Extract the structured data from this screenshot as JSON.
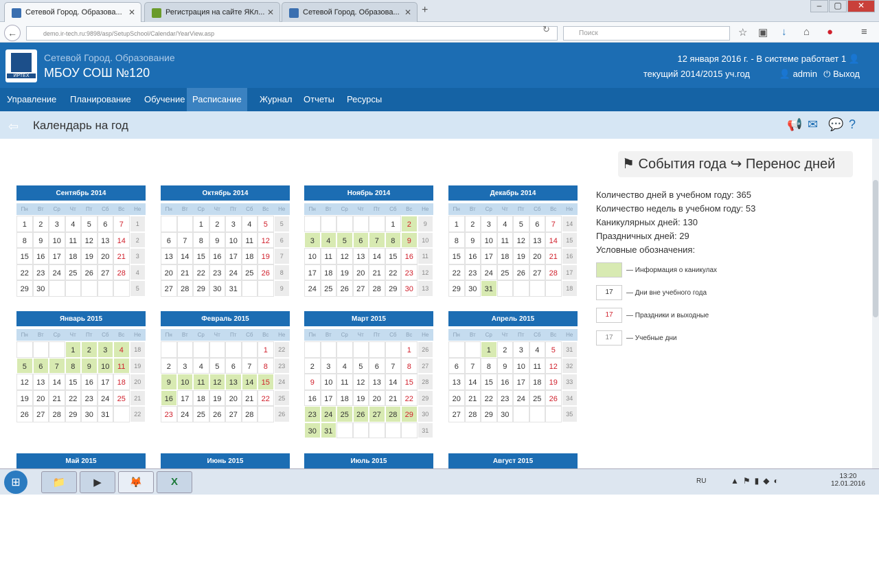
{
  "browser": {
    "tabs": [
      {
        "title": "Сетевой Город. Образова...",
        "favicon": "#3a6fb0",
        "active": true
      },
      {
        "title": "Регистрация на сайте ЯКл...",
        "favicon": "#6a9b2a",
        "active": false
      },
      {
        "title": "Сетевой Город. Образова...",
        "favicon": "#3a6fb0",
        "active": false
      }
    ],
    "url": "demo.ir-tech.ru:9898/asp/SetupSchool/Calendar/YearView.asp",
    "search_placeholder": "Поиск",
    "toolbar_icons": [
      "star-icon",
      "clipboard-icon",
      "download-icon",
      "home-icon",
      "adblock-icon",
      "menu-icon"
    ]
  },
  "app": {
    "system_name": "Сетевой Город. Образование",
    "school": "МБОУ СОШ №120",
    "logo_text": "ИРТЕХ",
    "date_status": "12 января 2016 г. - В системе работает 1",
    "year": "текущий 2014/2015 уч.год",
    "user": "admin",
    "logout": "Выход"
  },
  "menu": [
    "Управление",
    "Планирование",
    "Обучение",
    "Расписание",
    "Журнал",
    "Отчеты",
    "Ресурсы"
  ],
  "menu_active_index": 3,
  "page_title": "Календарь на год",
  "events_button": "События года",
  "transfer_button": "Перенос дней",
  "weekdays": [
    "Пн",
    "Вт",
    "Ср",
    "Чт",
    "Пт",
    "Сб",
    "Вс",
    "Не"
  ],
  "months": [
    {
      "title": "Сентябрь 2014",
      "rows": [
        [
          "1",
          "2",
          "3",
          "4",
          "5",
          "6",
          "7",
          "1"
        ],
        [
          "8",
          "9",
          "10",
          "11",
          "12",
          "13",
          "14",
          "2"
        ],
        [
          "15",
          "16",
          "17",
          "18",
          "19",
          "20",
          "21",
          "3"
        ],
        [
          "22",
          "23",
          "24",
          "25",
          "26",
          "27",
          "28",
          "4"
        ],
        [
          "29",
          "30",
          "",
          "",
          "",
          "",
          "",
          "5"
        ]
      ],
      "types": [
        [
          "s",
          "s",
          "s",
          "s",
          "s",
          "s",
          "h",
          "w"
        ],
        [
          "s",
          "s",
          "s",
          "s",
          "s",
          "s",
          "h",
          "w"
        ],
        [
          "s",
          "s",
          "s",
          "s",
          "s",
          "s",
          "h",
          "w"
        ],
        [
          "s",
          "s",
          "s",
          "s",
          "s",
          "s",
          "h",
          "w"
        ],
        [
          "s",
          "s",
          "e",
          "e",
          "e",
          "e",
          "e",
          "w"
        ]
      ]
    },
    {
      "title": "Октябрь 2014",
      "rows": [
        [
          "",
          "",
          "1",
          "2",
          "3",
          "4",
          "5",
          "5"
        ],
        [
          "6",
          "7",
          "8",
          "9",
          "10",
          "11",
          "12",
          "6"
        ],
        [
          "13",
          "14",
          "15",
          "16",
          "17",
          "18",
          "19",
          "7"
        ],
        [
          "20",
          "21",
          "22",
          "23",
          "24",
          "25",
          "26",
          "8"
        ],
        [
          "27",
          "28",
          "29",
          "30",
          "31",
          "",
          "",
          "9"
        ]
      ],
      "types": [
        [
          "e",
          "e",
          "s",
          "s",
          "s",
          "s",
          "h",
          "w"
        ],
        [
          "s",
          "s",
          "s",
          "s",
          "s",
          "s",
          "h",
          "w"
        ],
        [
          "s",
          "s",
          "s",
          "s",
          "s",
          "s",
          "h",
          "w"
        ],
        [
          "s",
          "s",
          "s",
          "s",
          "s",
          "s",
          "h",
          "w"
        ],
        [
          "s",
          "s",
          "s",
          "s",
          "s",
          "e",
          "e",
          "w"
        ]
      ]
    },
    {
      "title": "Ноябрь 2014",
      "rows": [
        [
          "",
          "",
          "",
          "",
          "",
          "1",
          "2",
          "9"
        ],
        [
          "3",
          "4",
          "5",
          "6",
          "7",
          "8",
          "9",
          "10"
        ],
        [
          "10",
          "11",
          "12",
          "13",
          "14",
          "15",
          "16",
          "11"
        ],
        [
          "17",
          "18",
          "19",
          "20",
          "21",
          "22",
          "23",
          "12"
        ],
        [
          "24",
          "25",
          "26",
          "27",
          "28",
          "29",
          "30",
          "13"
        ]
      ],
      "types": [
        [
          "e",
          "e",
          "e",
          "e",
          "e",
          "s",
          "v",
          "w"
        ],
        [
          "v",
          "v",
          "v",
          "v",
          "v",
          "v",
          "v",
          "w"
        ],
        [
          "s",
          "s",
          "s",
          "s",
          "s",
          "s",
          "h",
          "w"
        ],
        [
          "s",
          "s",
          "s",
          "s",
          "s",
          "s",
          "h",
          "w"
        ],
        [
          "s",
          "s",
          "s",
          "s",
          "s",
          "s",
          "h",
          "w"
        ]
      ]
    },
    {
      "title": "Декабрь 2014",
      "rows": [
        [
          "1",
          "2",
          "3",
          "4",
          "5",
          "6",
          "7",
          "14"
        ],
        [
          "8",
          "9",
          "10",
          "11",
          "12",
          "13",
          "14",
          "15"
        ],
        [
          "15",
          "16",
          "17",
          "18",
          "19",
          "20",
          "21",
          "16"
        ],
        [
          "22",
          "23",
          "24",
          "25",
          "26",
          "27",
          "28",
          "17"
        ],
        [
          "29",
          "30",
          "31",
          "",
          "",
          "",
          "",
          "18"
        ]
      ],
      "types": [
        [
          "s",
          "s",
          "s",
          "s",
          "s",
          "s",
          "h",
          "w"
        ],
        [
          "s",
          "s",
          "s",
          "s",
          "s",
          "s",
          "h",
          "w"
        ],
        [
          "s",
          "s",
          "s",
          "s",
          "s",
          "s",
          "h",
          "w"
        ],
        [
          "s",
          "s",
          "s",
          "s",
          "s",
          "s",
          "h",
          "w"
        ],
        [
          "s",
          "s",
          "v",
          "e",
          "e",
          "e",
          "e",
          "w"
        ]
      ]
    },
    {
      "title": "Январь 2015",
      "rows": [
        [
          "",
          "",
          "",
          "1",
          "2",
          "3",
          "4",
          "18"
        ],
        [
          "5",
          "6",
          "7",
          "8",
          "9",
          "10",
          "11",
          "19"
        ],
        [
          "12",
          "13",
          "14",
          "15",
          "16",
          "17",
          "18",
          "20"
        ],
        [
          "19",
          "20",
          "21",
          "22",
          "23",
          "24",
          "25",
          "21"
        ],
        [
          "26",
          "27",
          "28",
          "29",
          "30",
          "31",
          "",
          "22"
        ]
      ],
      "types": [
        [
          "e",
          "e",
          "e",
          "v",
          "v",
          "v",
          "v",
          "w"
        ],
        [
          "v",
          "v",
          "v",
          "v",
          "v",
          "v",
          "v",
          "w"
        ],
        [
          "s",
          "s",
          "s",
          "s",
          "s",
          "s",
          "h",
          "w"
        ],
        [
          "s",
          "s",
          "s",
          "s",
          "s",
          "s",
          "h",
          "w"
        ],
        [
          "s",
          "s",
          "s",
          "s",
          "s",
          "s",
          "e",
          "w"
        ]
      ]
    },
    {
      "title": "Февраль 2015",
      "rows": [
        [
          "",
          "",
          "",
          "",
          "",
          "",
          "1",
          "22"
        ],
        [
          "2",
          "3",
          "4",
          "5",
          "6",
          "7",
          "8",
          "23"
        ],
        [
          "9",
          "10",
          "11",
          "12",
          "13",
          "14",
          "15",
          "24"
        ],
        [
          "16",
          "17",
          "18",
          "19",
          "20",
          "21",
          "22",
          "25"
        ],
        [
          "23",
          "24",
          "25",
          "26",
          "27",
          "28",
          "",
          "26"
        ]
      ],
      "types": [
        [
          "e",
          "e",
          "e",
          "e",
          "e",
          "e",
          "h",
          "w"
        ],
        [
          "s",
          "s",
          "s",
          "s",
          "s",
          "s",
          "h",
          "w"
        ],
        [
          "v",
          "v",
          "v",
          "v",
          "v",
          "v",
          "v",
          "w"
        ],
        [
          "v",
          "s",
          "s",
          "s",
          "s",
          "s",
          "h",
          "w"
        ],
        [
          "h",
          "s",
          "s",
          "s",
          "s",
          "s",
          "e",
          "w"
        ]
      ]
    },
    {
      "title": "Март 2015",
      "rows": [
        [
          "",
          "",
          "",
          "",
          "",
          "",
          "1",
          "26"
        ],
        [
          "2",
          "3",
          "4",
          "5",
          "6",
          "7",
          "8",
          "27"
        ],
        [
          "9",
          "10",
          "11",
          "12",
          "13",
          "14",
          "15",
          "28"
        ],
        [
          "16",
          "17",
          "18",
          "19",
          "20",
          "21",
          "22",
          "29"
        ],
        [
          "23",
          "24",
          "25",
          "26",
          "27",
          "28",
          "29",
          "30"
        ],
        [
          "30",
          "31",
          "",
          "",
          "",
          "",
          "",
          "31"
        ]
      ],
      "types": [
        [
          "e",
          "e",
          "e",
          "e",
          "e",
          "e",
          "h",
          "w"
        ],
        [
          "s",
          "s",
          "s",
          "s",
          "s",
          "s",
          "h",
          "w"
        ],
        [
          "h",
          "s",
          "s",
          "s",
          "s",
          "s",
          "h",
          "w"
        ],
        [
          "s",
          "s",
          "s",
          "s",
          "s",
          "s",
          "h",
          "w"
        ],
        [
          "v",
          "v",
          "v",
          "v",
          "v",
          "v",
          "v",
          "w"
        ],
        [
          "v",
          "v",
          "e",
          "e",
          "e",
          "e",
          "e",
          "w"
        ]
      ]
    },
    {
      "title": "Апрель 2015",
      "rows": [
        [
          "",
          "",
          "1",
          "2",
          "3",
          "4",
          "5",
          "31"
        ],
        [
          "6",
          "7",
          "8",
          "9",
          "10",
          "11",
          "12",
          "32"
        ],
        [
          "13",
          "14",
          "15",
          "16",
          "17",
          "18",
          "19",
          "33"
        ],
        [
          "20",
          "21",
          "22",
          "23",
          "24",
          "25",
          "26",
          "34"
        ],
        [
          "27",
          "28",
          "29",
          "30",
          "",
          "",
          "",
          "35"
        ]
      ],
      "types": [
        [
          "e",
          "e",
          "v",
          "s",
          "s",
          "s",
          "h",
          "w"
        ],
        [
          "s",
          "s",
          "s",
          "s",
          "s",
          "s",
          "h",
          "w"
        ],
        [
          "s",
          "s",
          "s",
          "s",
          "s",
          "s",
          "h",
          "w"
        ],
        [
          "s",
          "s",
          "s",
          "s",
          "s",
          "s",
          "h",
          "w"
        ],
        [
          "s",
          "s",
          "s",
          "s",
          "e",
          "e",
          "e",
          "w"
        ]
      ]
    },
    {
      "title": "Май 2015",
      "rows": [],
      "types": []
    },
    {
      "title": "Июнь 2015",
      "rows": [],
      "types": []
    },
    {
      "title": "Июль 2015",
      "rows": [],
      "types": []
    },
    {
      "title": "Август 2015",
      "rows": [],
      "types": []
    }
  ],
  "stats": [
    "Количество дней в учебном году: 365",
    "Количество недель в учебном году: 53",
    "Каникулярных дней: 130",
    "Праздничных дней: 29",
    "Условные обозначения:"
  ],
  "legend": [
    {
      "sample": "",
      "label": "— Информация о каникулах",
      "bg": "#d8eab2",
      "color": "#333"
    },
    {
      "sample": "17",
      "label": "— Дни вне учебного года",
      "bg": "#ffffff",
      "color": "#333"
    },
    {
      "sample": "17",
      "label": "— Праздники и выходные",
      "bg": "#ffffff",
      "color": "#d0202c"
    },
    {
      "sample": "17",
      "label": "— Учебные дни",
      "bg": "#ffffff",
      "color": "#888"
    }
  ],
  "taskbar": {
    "lang": "RU",
    "time": "13:20",
    "date": "12.01.2016"
  },
  "colors": {
    "brand": "#1c6db3",
    "vacation": "#d8eab2",
    "holiday": "#d0202c"
  }
}
